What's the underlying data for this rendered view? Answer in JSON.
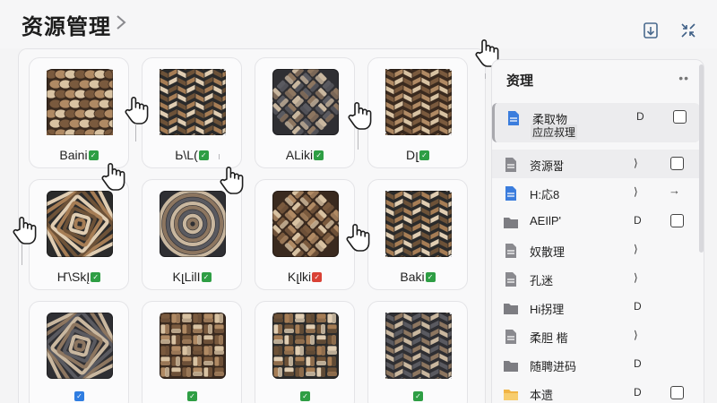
{
  "header": {
    "title": "资源管理",
    "colors": {
      "accent": "#2f7de1",
      "badge_green": "#2e9e44",
      "badge_red": "#d94135"
    }
  },
  "tiles": [
    {
      "label": "Baini",
      "badge": "green",
      "pattern": "scales"
    },
    {
      "label": "Ь\\L(",
      "badge": "green",
      "pattern": "herringbone"
    },
    {
      "label": "ALіki",
      "badge": "green",
      "pattern": "basket"
    },
    {
      "label": "Dլ",
      "badge": "green",
      "pattern": "zigzag"
    },
    {
      "label": "Ҥ\\SkĮ",
      "badge": "green",
      "pattern": "spiral-square"
    },
    {
      "label": "KլLіlӀ",
      "badge": "green",
      "pattern": "swirl"
    },
    {
      "label": "Kլlki",
      "badge": "red",
      "pattern": "weave"
    },
    {
      "label": "Baki",
      "badge": "green",
      "pattern": "chevron"
    },
    {
      "label": "",
      "badge": "blue",
      "pattern": "knot"
    },
    {
      "label": "",
      "badge": "green",
      "pattern": "plaid"
    },
    {
      "label": "",
      "badge": "green",
      "pattern": "mesh"
    },
    {
      "label": "",
      "badge": "green",
      "pattern": "herringbone"
    }
  ],
  "side": {
    "title": "资理",
    "more": "••",
    "items": [
      {
        "name": "柔取物",
        "sub": "应应叔理",
        "icon": "doc-blue",
        "meta": "D",
        "control": "checkbox"
      },
      {
        "name": "资源짧",
        "icon": "doc-gray",
        "meta": "⟩",
        "control": "checkbox"
      },
      {
        "name": "H:応8",
        "icon": "doc-blue",
        "meta": "⟩",
        "control": "arrow",
        "arrow": "→"
      },
      {
        "name": "AEIlP'",
        "icon": "folder",
        "meta": "D",
        "control": "checkbox"
      },
      {
        "name": "奴散理",
        "icon": "doc-gray",
        "meta": "⟩",
        "control": "none"
      },
      {
        "name": "孔迷",
        "icon": "doc-gray",
        "meta": "⟩",
        "control": "none"
      },
      {
        "name": "Hi拐理",
        "icon": "folder",
        "meta": "D",
        "control": "none"
      },
      {
        "name": "柔胆 楷",
        "icon": "doc-gray",
        "meta": "⟩",
        "control": "none"
      },
      {
        "name": "随聘进码",
        "icon": "folder",
        "meta": "D",
        "control": "none"
      },
      {
        "name": "本遗",
        "icon": "folder-open",
        "meta": "D",
        "control": "checkbox"
      }
    ]
  }
}
